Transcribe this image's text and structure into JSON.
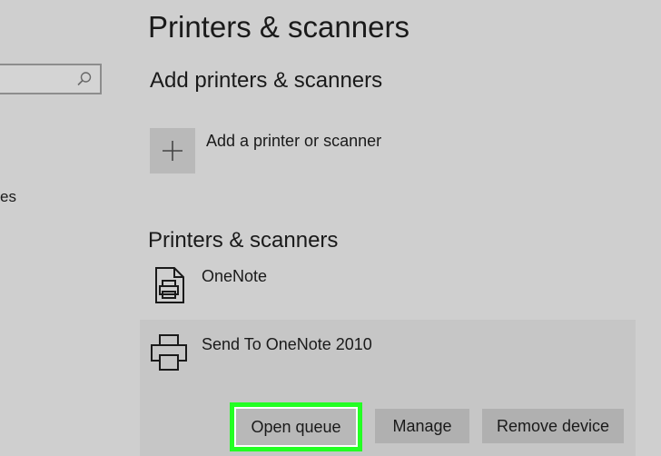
{
  "page": {
    "title": "Printers & scanners"
  },
  "sidebar": {
    "search_placeholder": "",
    "fragment_text": "es"
  },
  "add_section": {
    "title": "Add printers & scanners",
    "add_label": "Add a printer or scanner"
  },
  "list_section": {
    "title": "Printers & scanners",
    "devices": [
      {
        "name": "OneNote",
        "icon": "document-printer-icon"
      },
      {
        "name": "Send To OneNote 2010",
        "icon": "printer-icon"
      }
    ]
  },
  "actions": {
    "open_queue": "Open queue",
    "manage": "Manage",
    "remove_device": "Remove device"
  },
  "colors": {
    "background": "#cfcfcf",
    "selected_row": "#c6c6c6",
    "button": "#b0b0b0",
    "highlight": "#23ff23"
  }
}
